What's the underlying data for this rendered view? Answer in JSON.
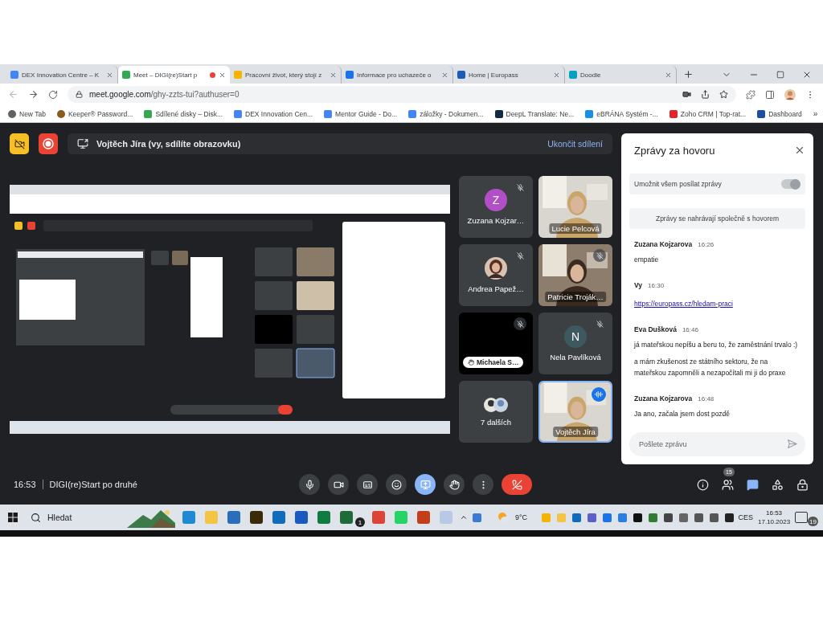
{
  "browser": {
    "tabs": [
      {
        "title": "DEX Innovation Centre – K",
        "selected": false,
        "recording": false
      },
      {
        "title": "Meet – DIGI(re)Start p",
        "selected": true,
        "recording": true
      },
      {
        "title": "Pracovní život, který stojí z",
        "selected": false,
        "recording": false
      },
      {
        "title": "Informace pro uchazeče o",
        "selected": false,
        "recording": false
      },
      {
        "title": "Home | Europass",
        "selected": false,
        "recording": false
      },
      {
        "title": "Doodle",
        "selected": false,
        "recording": false
      }
    ],
    "url": {
      "host": "meet.google.com",
      "path": "/ghy-zzts-tui?authuser=0"
    },
    "bookmarks": [
      "New Tab",
      "Keeper® Password...",
      "Sdílené disky – Disk...",
      "DEX Innovation Cen...",
      "Mentor Guide - Do...",
      "záložky - Dokumen...",
      "DeepL Translate: Ne...",
      "eBRÁNA Systém -...",
      "Zoho CRM | Top-rat...",
      "Dashboard"
    ],
    "bookmarks_more": "»"
  },
  "meet": {
    "presenting": {
      "text": "Vojtěch Jíra (vy, sdílíte obrazovku)",
      "stop": "Ukončit sdílení"
    },
    "tiles": [
      {
        "kind": "avatar",
        "name": "Zuzana Kojzar…",
        "initial": "Z",
        "color": "#b24fc6",
        "muted": true,
        "hand_raised": false,
        "speaking": false
      },
      {
        "kind": "video",
        "name": "Lucie Pelcová",
        "muted": false,
        "hand_raised": false,
        "speaking": false
      },
      {
        "name": "Andrea Papež…",
        "muted": true,
        "hand_raised": false,
        "speaking": false
      },
      {
        "kind": "video",
        "name": "Patricie Troják…",
        "muted": true,
        "hand_raised": false,
        "speaking": false
      },
      {
        "kind": "dark",
        "name": "Michaela S…",
        "muted": true,
        "hand_raised": true,
        "speaking": false
      },
      {
        "kind": "avatar",
        "name": "Nela Pavlíková",
        "initial": "N",
        "color": "#3e5860",
        "muted": true,
        "hand_raised": false,
        "speaking": false
      },
      {
        "kind": "others",
        "name": "7 dalších",
        "muted": false,
        "hand_raised": false,
        "speaking": false
      },
      {
        "kind": "video",
        "name": "Vojtěch Jíra",
        "muted": false,
        "hand_raised": false,
        "speaking": true
      }
    ],
    "chat": {
      "title": "Zprávy za hovoru",
      "allow_all": {
        "label": "Umožnit všem posílat zprávy",
        "on": true
      },
      "notice": "Zprávy se nahrávají společně s hovorem",
      "messages": [
        {
          "sender": "Zuzana Kojzarova",
          "time": "16:26",
          "lines": [
            {
              "kind": "text",
              "text": "empatie"
            }
          ]
        },
        {
          "sender": "Vy",
          "time": "16:30",
          "lines": [
            {
              "kind": "link",
              "text": "https://europass.cz/hledam-praci"
            }
          ]
        },
        {
          "sender": "Eva Dušková",
          "time": "16:46",
          "lines": [
            {
              "kind": "text",
              "text": "já mateřskou nepíšu a beru to, že zaměstnání trvalo :)"
            },
            {
              "kind": "text",
              "text": "a mám zkušenost ze státního sektoru, že na mateřskou zapomněli a nezapočítali mi ji do praxe"
            }
          ]
        },
        {
          "sender": "Zuzana Kojzarova",
          "time": "16:48",
          "lines": [
            {
              "kind": "text",
              "text": "Ja ano, začala jsem dost pozdě"
            }
          ]
        }
      ],
      "placeholder": "Pošlete zprávu"
    },
    "bottom": {
      "time": "16:53",
      "title": "DIGI(re)Start po druhé",
      "controls": [
        {
          "kind": "mic",
          "selected": false
        },
        {
          "kind": "camera",
          "selected": false
        },
        {
          "kind": "captions",
          "selected": false
        },
        {
          "kind": "emoji",
          "selected": false
        },
        {
          "kind": "present",
          "selected": true
        },
        {
          "kind": "hand",
          "selected": false
        },
        {
          "kind": "more",
          "selected": false
        },
        {
          "kind": "hangup",
          "selected": false
        }
      ],
      "side": [
        {
          "kind": "info",
          "selected": false
        },
        {
          "kind": "people",
          "selected": false,
          "badge": "15"
        },
        {
          "kind": "chat",
          "selected": true
        },
        {
          "kind": "activities",
          "selected": false
        },
        {
          "kind": "lock",
          "selected": false
        }
      ]
    }
  },
  "taskbar": {
    "search": "Hledat",
    "apps": [
      {
        "kind": "edge"
      },
      {
        "kind": "folder"
      },
      {
        "kind": "store"
      },
      {
        "kind": "app"
      },
      {
        "kind": "outlook"
      },
      {
        "kind": "word"
      },
      {
        "kind": "excel"
      },
      {
        "kind": "teams",
        "badge": "1"
      },
      {
        "kind": "chrome"
      },
      {
        "kind": "whatsapp"
      },
      {
        "kind": "powerpoint"
      },
      {
        "kind": "paint"
      }
    ],
    "weather": "9°C",
    "language": "CES",
    "time": "16:53",
    "date": "17.10.2023",
    "notifications": "19"
  }
}
